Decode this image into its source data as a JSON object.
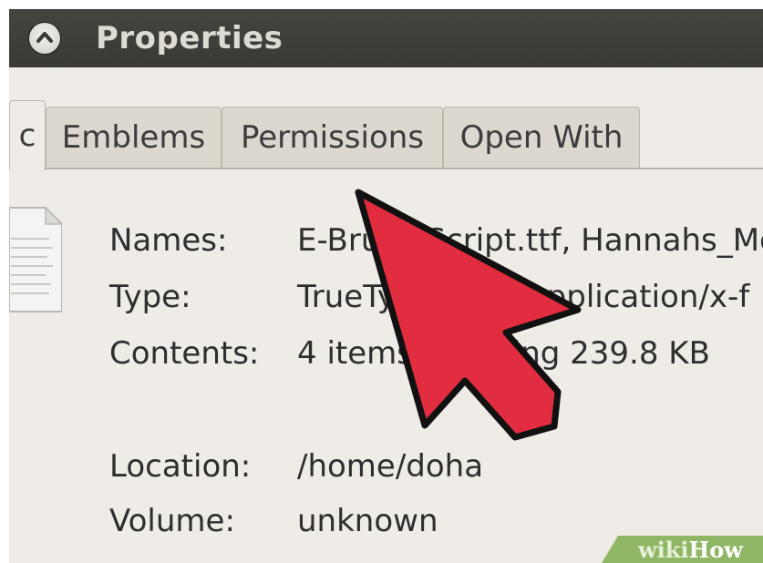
{
  "window": {
    "title": "Properties"
  },
  "tabs": [
    {
      "label": "c",
      "active": true
    },
    {
      "label": "Emblems",
      "active": false
    },
    {
      "label": "Permissions",
      "active": false
    },
    {
      "label": "Open With",
      "active": false
    }
  ],
  "info": {
    "names_label": "Names:",
    "names_value": "E-Brush Script.ttf, Hannahs_Me",
    "type_label": "Type:",
    "type_value": "TrueType font (application/x-f",
    "contents_label": "Contents:",
    "contents_value": "4 items, totalling 239.8 KB",
    "location_label": "Location:",
    "location_value": "/home/doha",
    "volume_label": "Volume:",
    "volume_value": "unknown"
  },
  "overlay": {
    "arrow_color": "#e12d3f",
    "watermark_wiki": "wiki",
    "watermark_how": "How"
  }
}
